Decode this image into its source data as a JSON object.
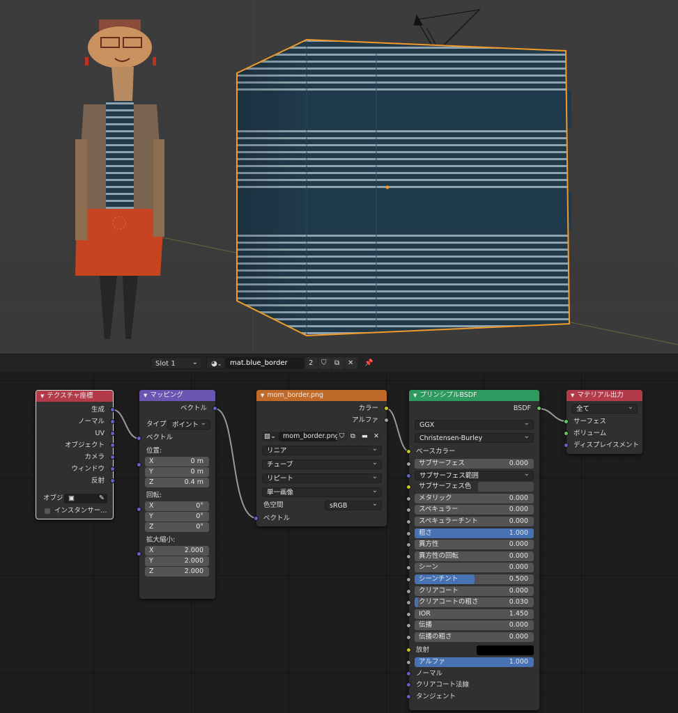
{
  "colors": {
    "selection_outline": "#f39a2b",
    "texcoord_header": "#b33a48",
    "mapping_header": "#6a55b3",
    "image_header": "#c06a2a",
    "bsdf_header": "#2f9a5f",
    "output_header": "#b33a48"
  },
  "header": {
    "slot": "Slot 1",
    "material_name": "mat.blue_border",
    "users": "2"
  },
  "texcoord": {
    "title": "テクスチャ座標",
    "outputs": [
      "生成",
      "ノーマル",
      "UV",
      "オブジェクト",
      "カメラ",
      "ウィンドウ",
      "反射"
    ],
    "object_label": "オブジ",
    "instancer": "インスタンサー..."
  },
  "mapping": {
    "title": "マッピング",
    "output": "ベクトル",
    "type_label": "タイプ",
    "type_value": "ポイント",
    "input_vector": "ベクトル",
    "location_label": "位置:",
    "location": [
      {
        "axis": "X",
        "value": "0 m"
      },
      {
        "axis": "Y",
        "value": "0 m"
      },
      {
        "axis": "Z",
        "value": "0.4 m"
      }
    ],
    "rotation_label": "回転:",
    "rotation": [
      {
        "axis": "X",
        "value": "0°"
      },
      {
        "axis": "Y",
        "value": "0°"
      },
      {
        "axis": "Z",
        "value": "0°"
      }
    ],
    "scale_label": "拡大縮小:",
    "scale": [
      {
        "axis": "X",
        "value": "2.000"
      },
      {
        "axis": "Y",
        "value": "2.000"
      },
      {
        "axis": "Z",
        "value": "2.000"
      }
    ]
  },
  "image": {
    "title": "mom_border.png",
    "out_color": "カラー",
    "out_alpha": "アルファ",
    "image_name": "mom_border.png",
    "interpolation": "リニア",
    "projection": "チューブ",
    "extension": "リピート",
    "source": "単一画像",
    "colorspace_label": "色空間",
    "colorspace": "sRGB",
    "input_vector": "ベクトル"
  },
  "bsdf": {
    "title": "プリンシプルBSDF",
    "output": "BSDF",
    "distribution": "GGX",
    "subsurface_method": "Christensen-Burley",
    "base_color": "ベースカラー",
    "fields": [
      {
        "label": "サブサーフェス",
        "value": "0.000",
        "fill": 0
      },
      {
        "label": "サブサーフェス範囲",
        "value": "",
        "fill": 0
      },
      {
        "label": "サブサーフェス色",
        "value": "",
        "fill": 0
      },
      {
        "label": "メタリック",
        "value": "0.000",
        "fill": 0
      },
      {
        "label": "スペキュラー",
        "value": "0.000",
        "fill": 0
      },
      {
        "label": "スペキュラーチント",
        "value": "0.000",
        "fill": 0
      },
      {
        "label": "粗さ",
        "value": "1.000",
        "fill": 1
      },
      {
        "label": "異方性",
        "value": "0.000",
        "fill": 0
      },
      {
        "label": "異方性の回転",
        "value": "0.000",
        "fill": 0
      },
      {
        "label": "シーン",
        "value": "0.000",
        "fill": 0
      },
      {
        "label": "シーンチント",
        "value": "0.500",
        "fill": 0.5
      },
      {
        "label": "クリアコート",
        "value": "0.000",
        "fill": 0
      },
      {
        "label": "クリアコートの粗さ",
        "value": "0.030",
        "fill": 0.03
      },
      {
        "label": "IOR",
        "value": "1.450",
        "fill": 0
      },
      {
        "label": "伝播",
        "value": "0.000",
        "fill": 0
      },
      {
        "label": "伝播の粗さ",
        "value": "0.000",
        "fill": 0
      }
    ],
    "emission": "放射",
    "alpha_label": "アルファ",
    "alpha_value": "1.000",
    "normal": "ノーマル",
    "clearcoat_normal": "クリアコート法線",
    "tangent": "タンジェント"
  },
  "output": {
    "title": "マテリアル出力",
    "target": "全て",
    "inputs": [
      "サーフェス",
      "ボリューム",
      "ディスプレイスメント"
    ]
  }
}
